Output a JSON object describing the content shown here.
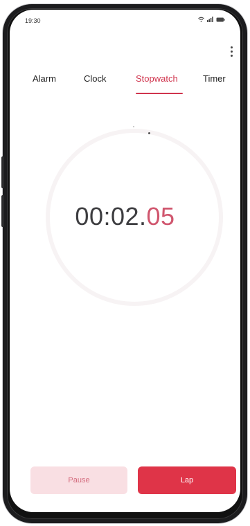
{
  "status_bar": {
    "time": "19:30"
  },
  "icons": {
    "wifi": "wifi-icon",
    "signal": "signal-icon",
    "battery": "battery-icon",
    "more": "more-vertical-icon"
  },
  "tabs": [
    {
      "label": "Alarm",
      "active": false
    },
    {
      "label": "Clock",
      "active": false
    },
    {
      "label": "Stopwatch",
      "active": true
    },
    {
      "label": "Timer",
      "active": false
    }
  ],
  "stopwatch": {
    "main": "00:02.",
    "hundredths": "05"
  },
  "buttons": {
    "pause_label": "Pause",
    "lap_label": "Lap"
  },
  "colors": {
    "accent": "#d0344d",
    "lap_button": "#df3448",
    "pause_button": "#f9dfe3"
  }
}
